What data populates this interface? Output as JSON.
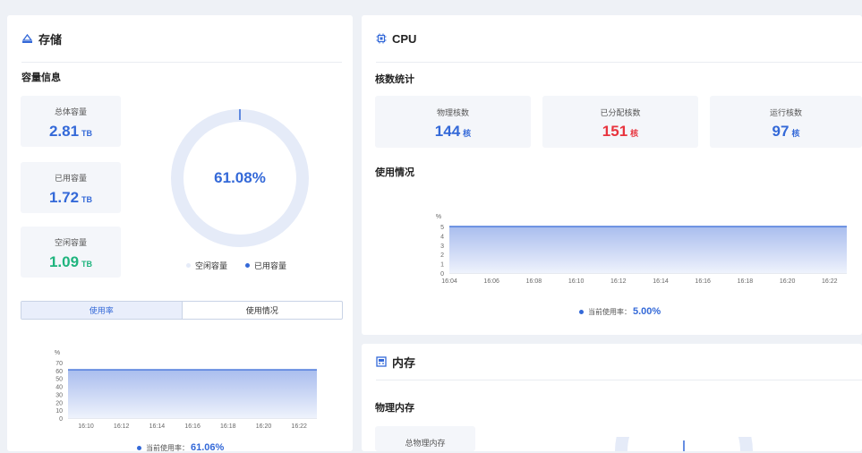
{
  "storage": {
    "title": "存储",
    "section_title": "容量信息",
    "cards": [
      {
        "label": "总体容量",
        "value": "2.81",
        "unit": "TB",
        "color": "#3469d8"
      },
      {
        "label": "已用容量",
        "value": "1.72",
        "unit": "TB",
        "color": "#3469d8"
      },
      {
        "label": "空闲容量",
        "value": "1.09",
        "unit": "TB",
        "color": "#1fb47e"
      }
    ],
    "donut": {
      "center_text": "61.08%",
      "used_percent": 61.08
    },
    "legend": {
      "free": "空闲容量",
      "used": "已用容量"
    },
    "tabs": {
      "usage_rate": "使用率",
      "usage": "使用情况"
    },
    "chart_caption": {
      "label": "当前使用率：",
      "value": "61.06%"
    }
  },
  "cpu": {
    "title": "CPU",
    "section_title": "核数统计",
    "cards": [
      {
        "label": "物理核数",
        "value": "144",
        "unit": "核",
        "color": "#3469d8"
      },
      {
        "label": "已分配核数",
        "value": "151",
        "unit": "核",
        "color": "#e8343e"
      },
      {
        "label": "运行核数",
        "value": "97",
        "unit": "核",
        "color": "#3469d8"
      }
    ],
    "usage_title": "使用情况",
    "chart_caption": {
      "label": "当前使用率：",
      "value": "5.00%"
    }
  },
  "memory": {
    "title": "内存",
    "section_title": "物理内存",
    "card_label": "总物理内存"
  },
  "colors": {
    "accent": "#3469d8",
    "green": "#1fb47e",
    "red": "#e8343e",
    "area_fill": "#b8c8f0"
  },
  "chart_data": [
    {
      "type": "area",
      "ylabel": "%",
      "ylim": [
        0,
        5
      ],
      "yticks": [
        0,
        1,
        2,
        3,
        4,
        5
      ],
      "x": [
        "16:04",
        "16:06",
        "16:08",
        "16:10",
        "16:12",
        "16:14",
        "16:16",
        "16:18",
        "16:20",
        "16:22"
      ],
      "values": [
        5,
        5,
        5,
        5,
        5,
        5,
        5,
        5,
        5,
        5
      ]
    },
    {
      "type": "area",
      "ylabel": "%",
      "ylim": [
        0,
        70
      ],
      "yticks": [
        0,
        10,
        20,
        30,
        40,
        50,
        60,
        70
      ],
      "x": [
        "16:10",
        "16:12",
        "16:14",
        "16:16",
        "16:18",
        "16:20",
        "16:22"
      ],
      "values": [
        61,
        61,
        61,
        61,
        61,
        61,
        61
      ]
    }
  ]
}
